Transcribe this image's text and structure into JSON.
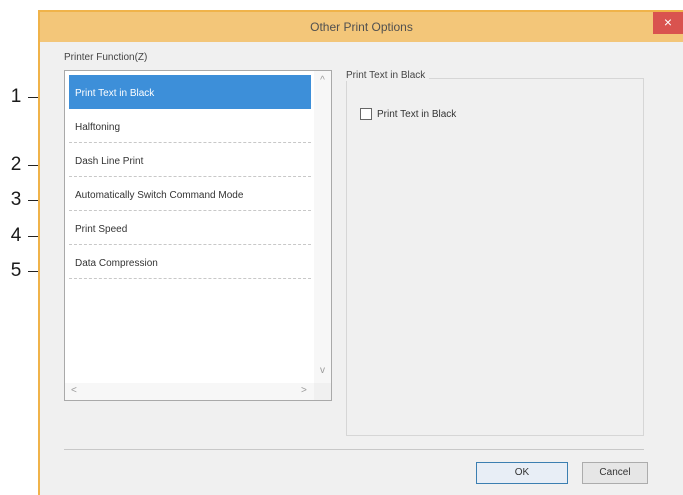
{
  "dialog": {
    "title": "Other Print Options",
    "close_glyph": "×"
  },
  "printer_function": {
    "group_label": "Printer Function(Z)",
    "items": [
      {
        "label": "Print Text in Black",
        "selected": true
      },
      {
        "label": "Halftoning",
        "selected": false
      },
      {
        "label": "Dash Line Print",
        "selected": false
      },
      {
        "label": "Automatically Switch Command Mode",
        "selected": false
      },
      {
        "label": "Print Speed",
        "selected": false
      },
      {
        "label": "Data Compression",
        "selected": false
      }
    ],
    "scroll_up_glyph": "^",
    "scroll_down_glyph": "v",
    "scroll_left_glyph": "<",
    "scroll_right_glyph": ">"
  },
  "settings": {
    "group_title": "Print Text in Black",
    "checkbox_label": "Print Text in Black",
    "checkbox_checked": false
  },
  "buttons": {
    "ok_label": "OK",
    "cancel_label": "Cancel"
  },
  "callouts": [
    "1",
    "2",
    "3",
    "4",
    "5"
  ],
  "colors": {
    "titlebar": "#f3c679",
    "selection": "#3d8fd9",
    "close_button": "#d9534f"
  }
}
